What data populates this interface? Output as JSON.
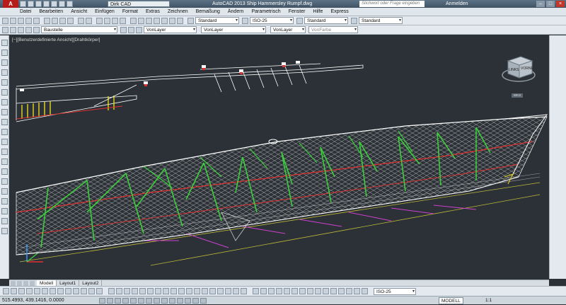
{
  "app": {
    "logo": "A",
    "workspace": "Dirk CAD",
    "title": "AutoCAD 2013    Ship Hammersley Rumpf.dwg",
    "search_placeholder": "Stichwort oder Frage eingeben",
    "login_label": "Anmelden"
  },
  "menu": {
    "items": [
      "Datei",
      "Bearbeiten",
      "Ansicht",
      "Einfügen",
      "Format",
      "Extras",
      "Zeichnen",
      "Bemaßung",
      "Ändern",
      "Parametrisch",
      "Fenster",
      "Hilfe",
      "Express"
    ]
  },
  "toolbar1": {
    "text_style": "Standard",
    "dim_style": "ISO-25",
    "table_style": "Standard",
    "multileader_style": "Standard"
  },
  "toolbar2": {
    "layer": "Baustelle",
    "color": "VonLayer",
    "linetype": "VonLayer",
    "lineweight": "VonLayer",
    "plotstyle": "VonFarbe"
  },
  "viewport": {
    "label": "[−][Benutzerdefinierte Ansicht][Drahtkörper]",
    "viewcube_left": "LINKS",
    "viewcube_front": "VORNE",
    "wcs_label": "WKS"
  },
  "tabs": [
    "Modell",
    "Layout1",
    "Layout2"
  ],
  "bottom_toolbar": {
    "dim_style": "ISO-25"
  },
  "status": {
    "coordinates": "515.4993, 439.1416, 0.0000",
    "model_label": "MODELL",
    "scale": "1:1"
  },
  "colors": {
    "canvas_bg": "#2b3136",
    "frame_green": "#3ccf3c",
    "accent_red": "#e03030",
    "accent_yellow": "#e8d81e",
    "accent_magenta": "#e040e0"
  }
}
